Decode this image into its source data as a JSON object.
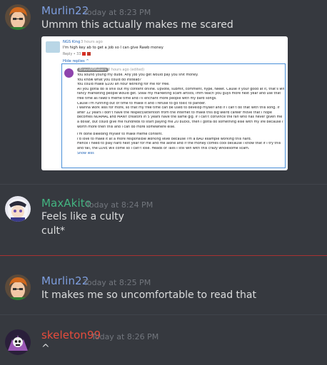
{
  "messages": [
    {
      "author": "Murlin22",
      "author_color": "#7e9fe0",
      "timestamp": "Today at 8:23 PM",
      "lines": [
        "Ummm this actually makes me scared"
      ],
      "avatar_icon": "orange-hair-avatar"
    },
    {
      "author": "MaxAkito",
      "author_color": "#43b581",
      "timestamp": "Today at 8:24 PM",
      "lines": [
        "Feels like a culty",
        "cult*"
      ],
      "avatar_icon": "anime-girl-avatar"
    },
    {
      "author": "Murlin22",
      "author_color": "#7e9fe0",
      "timestamp": "Today at 8:25 PM",
      "lines": [
        "It makes me so uncomfortable to read that"
      ],
      "avatar_icon": "orange-hair-avatar"
    },
    {
      "author": "skeleton99",
      "author_color": "#e74c3c",
      "timestamp": "Today at 8:26 PM",
      "lines": [
        "^"
      ],
      "avatar_icon": "skeleton-avatar"
    }
  ],
  "embed": {
    "top_comment": {
      "author": "NGS King",
      "time": "3 hours ago",
      "text": "I'm high key ab to get a job so I can give Rawb money",
      "actions": "Reply • 33"
    },
    "hide_replies": "Hide replies ^",
    "reply": {
      "author": "BravoMMakers",
      "time": "3 hours ago (edited)",
      "lines": [
        "You sound young my dude. Any job you get would pay you shit money.",
        "You know what you could do instead?",
        "You could make $100 an hour working for me for free.",
        "All you gotta do is shill out my content online. Upvote, submit, comment, hype, tweet. Cause if your good at it, that's what",
        "fancy marketing people would get. Steal my marketing scam artists, imm teach you guys more next year and use that",
        "free time as rawb's meme time and I'll enchant more people with my bard songs.",
        "Cause I'm running out of time to make it and I refuse to go toxic to pander.",
        "I wanna work less for more, so that my free time can be used to develop myself and if I can't do that with this song. If",
        "after 12 years I don't have the respect/attention from the internet to make this big weird career move that I hope",
        "becomes NORMAL and MANY creators in 5 years have the same gig. If I can't convince the fan who has never given me",
        "a dollar, but could give me hundreds to start paying me 20 bucks, then I gotta do something else with my life because I'm",
        "worth more then this and I can do more somewhere else.",
        "",
        "I'm done bleeding myself to make meme content.",
        "I'd love to make it at a more responsible working level because I'm a BAD example working this hard.",
        "Hence I need to play hard next year for me and me alone and if the money comes cool because I know that if I try this",
        "and fail, the LOVE will come so I can't lose. Heads or Tails I still win with this crazy wholesome scam."
      ],
      "show_less": "Show less"
    }
  }
}
